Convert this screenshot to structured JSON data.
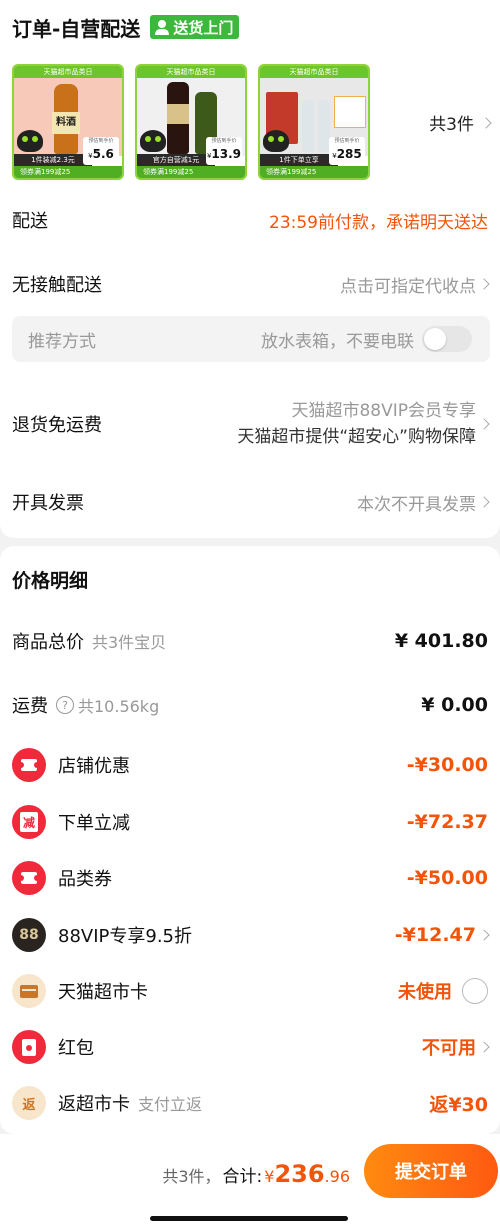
{
  "header": {
    "title": "订单-自营配送",
    "door_badge": "送货上门"
  },
  "products": {
    "items": [
      {
        "band_text": "天猫超市品类日",
        "tag": "1件装减2.3元",
        "promo": "领券满199减25",
        "price_tip": "预估到手价",
        "price": "5.6",
        "bottle_label": "料酒",
        "bg_color": "#f7c9b8",
        "bottle_color": "#c9711a"
      },
      {
        "band_text": "天猫超市品类日",
        "tag": "官方自营减1元",
        "promo": "领券满199减25",
        "price_tip": "预估到手价",
        "price": "13.9",
        "bottle_label": "",
        "bg_color": "#f0f0f0",
        "bottle_color": "#2a1410"
      },
      {
        "band_text": "天猫超市品类日",
        "tag": "1件下单立享",
        "promo": "领券满199减25",
        "price_tip": "预估到手价",
        "price": "285",
        "bottle_label": "",
        "bg_color": "#e8e8e8",
        "bottle_color": "#c43a2a"
      }
    ],
    "count_label": "共3件",
    "currency": "¥"
  },
  "delivery": {
    "label": "配送",
    "value": "23:59前付款，承诺明天送达"
  },
  "contactless": {
    "label": "无接触配送",
    "value": "点击可指定代收点"
  },
  "preference": {
    "label": "推荐方式",
    "value": "放水表箱，不要电联",
    "toggle_on": false
  },
  "return_shipping": {
    "label": "退货免运费",
    "line1": "天猫超市88VIP会员专享",
    "line2": "天猫超市提供“超安心”购物保障"
  },
  "invoice": {
    "label": "开具发票",
    "value": "本次不开具发票"
  },
  "price_detail": {
    "title": "价格明细",
    "subtotal": {
      "label": "商品总价",
      "sub": "共3件宝贝",
      "amount": "¥ 401.80"
    },
    "shipping": {
      "label": "运费",
      "help": "?",
      "sub": "共10.56kg",
      "amount": "¥ 0.00"
    },
    "store_discount": {
      "label": "店铺优惠",
      "amount": "-¥30.00"
    },
    "order_discount": {
      "label": "下单立减",
      "icon_text": "减",
      "amount": "-¥72.37"
    },
    "category_coupon": {
      "label": "品类券",
      "amount": "-¥50.00"
    },
    "vip": {
      "label": "88VIP专享9.5折",
      "icon_text": "88",
      "amount": "-¥12.47"
    },
    "tmall_card": {
      "label": "天猫超市卡",
      "amount": "未使用"
    },
    "red_packet": {
      "label": "红包",
      "amount": "不可用"
    },
    "cashback": {
      "label": "返超市卡",
      "icon_text": "返",
      "sub": "支付立返",
      "amount": "返¥30"
    }
  },
  "footer": {
    "count": "共3件，",
    "total_label": "合计:",
    "currency": "¥",
    "total_int": "236",
    "total_dec": ".96",
    "submit": "提交订单"
  },
  "colors": {
    "accent": "#f2540a",
    "badge_green": "#3cb83c",
    "icon_red": "#f02a3a"
  }
}
